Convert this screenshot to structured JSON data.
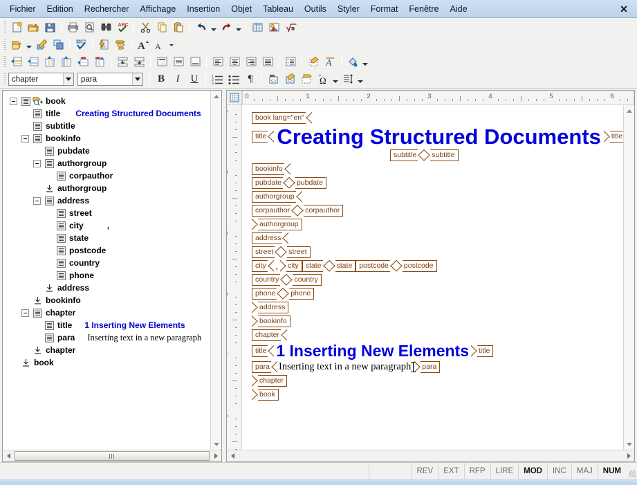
{
  "window": {
    "close_label": "✕",
    "menu": [
      "Fichier",
      "Edition",
      "Rechercher",
      "Affichage",
      "Insertion",
      "Objet",
      "Tableau",
      "Outils",
      "Styler",
      "Format",
      "Fenêtre",
      "Aide"
    ]
  },
  "toolbar": {
    "row1": [
      {
        "name": "new-document",
        "icon": "new-document-icon"
      },
      {
        "name": "open-document",
        "icon": "open-folder-icon"
      },
      {
        "name": "save-document",
        "icon": "save-disk-icon"
      },
      {
        "sep": true
      },
      {
        "name": "print",
        "icon": "printer-icon"
      },
      {
        "name": "print-preview",
        "icon": "page-preview-icon"
      },
      {
        "name": "find",
        "icon": "binoculars-icon"
      },
      {
        "name": "spellcheck",
        "icon": "abc-check-icon"
      },
      {
        "sep": true
      },
      {
        "name": "cut",
        "icon": "scissors-icon"
      },
      {
        "name": "copy",
        "icon": "copy-icon"
      },
      {
        "name": "paste",
        "icon": "paste-icon"
      },
      {
        "sep": true
      },
      {
        "name": "undo",
        "icon": "undo-arrow-icon",
        "dropdown": true
      },
      {
        "name": "redo",
        "icon": "redo-arrow-icon",
        "dropdown": true
      },
      {
        "sep": true
      },
      {
        "name": "insert-table",
        "icon": "table-grid-icon"
      },
      {
        "name": "insert-image",
        "icon": "image-icon"
      },
      {
        "name": "insert-formula",
        "icon": "sqrt-n-icon"
      }
    ],
    "row2": [
      {
        "name": "insert-element",
        "icon": "yellow-tag-icon",
        "dropdown": true
      },
      {
        "name": "edit-element",
        "icon": "pencil-tag-icon"
      },
      {
        "name": "duplicate-element",
        "icon": "duplicate-icon"
      },
      {
        "sep": true
      },
      {
        "name": "validate-document",
        "icon": "validate-check-icon"
      },
      {
        "sep": true
      },
      {
        "name": "apply-transform",
        "icon": "lightning-page-icon"
      },
      {
        "name": "structure-view",
        "icon": "structure-list-icon"
      },
      {
        "sep": true
      },
      {
        "name": "increase-font",
        "icon": "font-grow-icon"
      },
      {
        "name": "decrease-font",
        "icon": "font-shrink-icon",
        "dropdown": true
      }
    ],
    "row3": [
      {
        "name": "insert-row-above",
        "icon": "row-insert-above-icon"
      },
      {
        "name": "insert-row-below",
        "icon": "row-insert-below-icon"
      },
      {
        "name": "insert-column-left",
        "icon": "column-insert-left-icon"
      },
      {
        "name": "insert-column-right",
        "icon": "column-insert-right-icon"
      },
      {
        "name": "delete-row",
        "icon": "row-delete-icon"
      },
      {
        "name": "delete-column",
        "icon": "column-delete-icon"
      },
      {
        "sep": true
      },
      {
        "name": "merge-cells",
        "icon": "merge-cells-icon"
      },
      {
        "name": "split-cells",
        "icon": "split-cells-icon"
      },
      {
        "sep": true
      },
      {
        "name": "align-top",
        "icon": "align-top-icon"
      },
      {
        "name": "align-middle",
        "icon": "align-middle-icon"
      },
      {
        "name": "align-bottom",
        "icon": "align-bottom-icon"
      },
      {
        "sep": true
      },
      {
        "name": "align-left",
        "icon": "align-left-icon"
      },
      {
        "name": "align-center",
        "icon": "align-center-icon"
      },
      {
        "name": "align-right",
        "icon": "align-right-icon"
      },
      {
        "name": "align-justify",
        "icon": "align-justify-icon"
      },
      {
        "sep": true
      },
      {
        "name": "paragraph-properties",
        "icon": "paragraph-props-icon"
      },
      {
        "sep": true
      },
      {
        "name": "highlight-cell",
        "icon": "cell-highlight-icon"
      },
      {
        "name": "text-style",
        "icon": "italic-a-icon"
      },
      {
        "sep": true
      },
      {
        "name": "fill-color",
        "icon": "paint-bucket-icon",
        "dropdown": true
      }
    ],
    "row4": [
      {
        "name": "insert-entity",
        "icon": "red-tag-code-icon"
      },
      {
        "name": "edit-source",
        "icon": "pencil-code-icon"
      },
      {
        "name": "show-tags",
        "icon": "dotted-tag-icon"
      },
      {
        "name": "special-character",
        "icon": "omega-icon",
        "dropdown": true
      },
      {
        "name": "line-spacing",
        "icon": "line-spacing-icon",
        "dropdown": true
      }
    ]
  },
  "style_bar": {
    "element_style": {
      "value": "chapter",
      "placeholder": "chapter"
    },
    "paragraph_style": {
      "value": "para",
      "placeholder": "para"
    },
    "bold_label": "B",
    "italic_label": "I",
    "underline_label": "U",
    "numbered_list": "numbered-list-icon",
    "bullet_list": "bullet-list-icon",
    "pilcrow_label": "¶"
  },
  "tree": {
    "rows": [
      {
        "depth": 0,
        "expander": "minus",
        "icon": "element-icon-root",
        "label": "book",
        "value": ""
      },
      {
        "depth": 1,
        "expander": "none",
        "icon": "element-icon",
        "label": "title",
        "value": "Creating Structured Documents",
        "value_style": "blue"
      },
      {
        "depth": 1,
        "expander": "none",
        "icon": "element-icon",
        "label": "subtitle",
        "value": ""
      },
      {
        "depth": 1,
        "expander": "minus",
        "icon": "element-icon",
        "label": "bookinfo",
        "value": ""
      },
      {
        "depth": 2,
        "expander": "none",
        "icon": "element-icon",
        "label": "pubdate",
        "value": ""
      },
      {
        "depth": 2,
        "expander": "minus",
        "icon": "element-icon",
        "label": "authorgroup",
        "value": ""
      },
      {
        "depth": 3,
        "expander": "none",
        "icon": "element-icon",
        "label": "corpauthor",
        "value": ""
      },
      {
        "depth": 2,
        "expander": "none",
        "icon": "end-tag-icon",
        "label": "authorgroup",
        "value": ""
      },
      {
        "depth": 2,
        "expander": "minus",
        "icon": "element-icon",
        "label": "address",
        "value": ""
      },
      {
        "depth": 3,
        "expander": "none",
        "icon": "element-icon",
        "label": "street",
        "value": ""
      },
      {
        "depth": 3,
        "expander": "none",
        "icon": "element-icon",
        "label": "city",
        "value": ",",
        "value_style": "blue"
      },
      {
        "depth": 3,
        "expander": "none",
        "icon": "element-icon",
        "label": "state",
        "value": ""
      },
      {
        "depth": 3,
        "expander": "none",
        "icon": "element-icon",
        "label": "postcode",
        "value": ""
      },
      {
        "depth": 3,
        "expander": "none",
        "icon": "element-icon",
        "label": "country",
        "value": ""
      },
      {
        "depth": 3,
        "expander": "none",
        "icon": "element-icon",
        "label": "phone",
        "value": ""
      },
      {
        "depth": 2,
        "expander": "none",
        "icon": "end-tag-icon",
        "label": "address",
        "value": ""
      },
      {
        "depth": 1,
        "expander": "none",
        "icon": "end-tag-icon",
        "label": "bookinfo",
        "value": ""
      },
      {
        "depth": 1,
        "expander": "minus",
        "icon": "element-icon",
        "label": "chapter",
        "value": ""
      },
      {
        "depth": 2,
        "expander": "none",
        "icon": "element-icon",
        "label": "title",
        "value": "1  Inserting New Elements",
        "value_style": "blue"
      },
      {
        "depth": 2,
        "expander": "none",
        "icon": "element-icon",
        "label": "para",
        "value": "Inserting text in a new paragraph",
        "value_style": "plain"
      },
      {
        "depth": 1,
        "expander": "none",
        "icon": "end-tag-icon",
        "label": "chapter",
        "value": ""
      },
      {
        "depth": 0,
        "expander": "none",
        "icon": "end-tag-icon",
        "label": "book",
        "value": ""
      }
    ]
  },
  "document": {
    "hruler_labels": [
      "0",
      "1",
      "2",
      "3",
      "4",
      "5",
      "6"
    ],
    "vruler_labels": [
      "0",
      "1",
      "2",
      "3",
      "4",
      "5"
    ],
    "lines": [
      {
        "type": "tags",
        "indent": 0,
        "tags": [
          {
            "kind": "open",
            "text": "book lang=\"en\""
          }
        ]
      },
      {
        "type": "heading-title",
        "indent": 0,
        "open_tag": "title",
        "text": "Creating Structured Documents",
        "close_tag": "title"
      },
      {
        "type": "tags",
        "indent": 200,
        "tags": [
          {
            "kind": "open",
            "text": "subtitle"
          },
          {
            "kind": "close",
            "text": "subtitle"
          }
        ]
      },
      {
        "type": "tags",
        "indent": 0,
        "tags": [
          {
            "kind": "open",
            "text": "bookinfo"
          }
        ]
      },
      {
        "type": "tags",
        "indent": 0,
        "tags": [
          {
            "kind": "open",
            "text": "pubdate"
          },
          {
            "kind": "close",
            "text": "pubdate"
          }
        ]
      },
      {
        "type": "tags",
        "indent": 0,
        "tags": [
          {
            "kind": "open",
            "text": "authorgroup"
          }
        ]
      },
      {
        "type": "tags",
        "indent": 0,
        "tags": [
          {
            "kind": "open",
            "text": "corpauthor"
          },
          {
            "kind": "close",
            "text": "corpauthor"
          }
        ]
      },
      {
        "type": "tags",
        "indent": 0,
        "tags": [
          {
            "kind": "close",
            "text": "authorgroup"
          }
        ]
      },
      {
        "type": "tags",
        "indent": 0,
        "tags": [
          {
            "kind": "open",
            "text": "address"
          }
        ]
      },
      {
        "type": "tags",
        "indent": 0,
        "tags": [
          {
            "kind": "open",
            "text": "street"
          },
          {
            "kind": "close",
            "text": "street"
          }
        ]
      },
      {
        "type": "tags",
        "indent": 0,
        "tags": [
          {
            "kind": "open",
            "text": "city"
          },
          {
            "kind": "text",
            "text": ","
          },
          {
            "kind": "close",
            "text": "city"
          },
          {
            "kind": "open",
            "text": "state"
          },
          {
            "kind": "close",
            "text": "state"
          },
          {
            "kind": "open",
            "text": "postcode"
          },
          {
            "kind": "close",
            "text": "postcode"
          }
        ]
      },
      {
        "type": "tags",
        "indent": 0,
        "tags": [
          {
            "kind": "open",
            "text": "country"
          },
          {
            "kind": "close",
            "text": "country"
          }
        ]
      },
      {
        "type": "tags",
        "indent": 0,
        "tags": [
          {
            "kind": "open",
            "text": "phone"
          },
          {
            "kind": "close",
            "text": "phone"
          }
        ]
      },
      {
        "type": "tags",
        "indent": 0,
        "tags": [
          {
            "kind": "close",
            "text": "address"
          }
        ]
      },
      {
        "type": "tags",
        "indent": 0,
        "tags": [
          {
            "kind": "close",
            "text": "bookinfo"
          }
        ]
      },
      {
        "type": "tags",
        "indent": 0,
        "tags": [
          {
            "kind": "open",
            "text": "chapter"
          }
        ]
      },
      {
        "type": "heading-h1",
        "indent": 0,
        "open_tag": "title",
        "text": "1  Inserting New Elements",
        "close_tag": "title"
      },
      {
        "type": "paragraph",
        "indent": 0,
        "open_tag": "para",
        "text": "Inserting text in a new paragraph",
        "close_tag": "para"
      },
      {
        "type": "tags",
        "indent": 0,
        "tags": [
          {
            "kind": "close",
            "text": "chapter"
          }
        ]
      },
      {
        "type": "tags",
        "indent": 0,
        "tags": [
          {
            "kind": "close",
            "text": "book"
          }
        ]
      }
    ]
  },
  "statusbar": {
    "cells": [
      {
        "label": "REV",
        "active": false
      },
      {
        "label": "EXT",
        "active": false
      },
      {
        "label": "RFP",
        "active": false
      },
      {
        "label": "LIRE",
        "active": false
      },
      {
        "label": "MOD",
        "active": true
      },
      {
        "label": "INC",
        "active": false
      },
      {
        "label": "MAJ",
        "active": false
      },
      {
        "label": "NUM",
        "active": true
      }
    ]
  },
  "colors": {
    "tag_border": "#8b4a12",
    "tag_text": "#7a3f10",
    "heading_blue": "#0000dd",
    "titlebar": "#bcd4ec"
  }
}
